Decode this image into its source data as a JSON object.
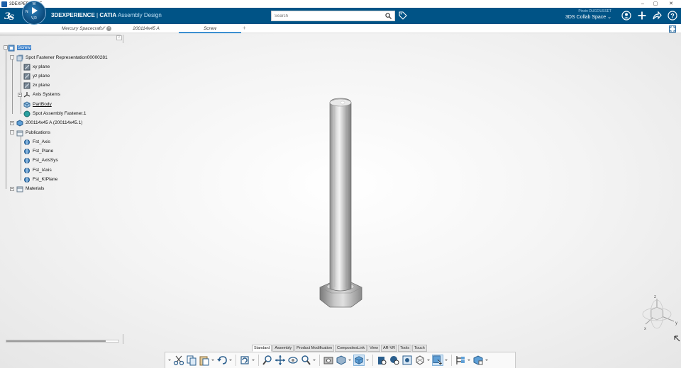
{
  "titlebar": {
    "title": "3DEXPERIENCE",
    "min": "–",
    "max": "▢",
    "close": "✕"
  },
  "header": {
    "brand_prefix": "3DEXPERIENCE",
    "brand_sep": " | ",
    "brand_product": "CATIA",
    "brand_app": " Assembly Design",
    "compass_top": "W",
    "compass_left": "N",
    "compass_label": "V,R",
    "search_placeholder": "Search",
    "user_name": "Pinxin DUGOUSSET",
    "collab_space": "3DS Collab Space ⌄"
  },
  "tabs": [
    {
      "label": "Mercury Spacecraft",
      "suffix": "⁄⁄",
      "closable": true,
      "active": false
    },
    {
      "label": "200114x45 A",
      "active": false
    },
    {
      "label": "Screw",
      "active": true
    }
  ],
  "tab_add": "+",
  "tree": {
    "root": "Screw",
    "nodes": [
      {
        "label": "Spot Fastener Representation00000281"
      },
      {
        "label": "xy plane"
      },
      {
        "label": "yz plane"
      },
      {
        "label": "zx plane"
      },
      {
        "label": "Axis Systems"
      },
      {
        "label": "PartBody"
      },
      {
        "label": "Spot Assembly Fastener.1"
      },
      {
        "label": "200114x45 A (200114x45.1)"
      },
      {
        "label": "Publications"
      },
      {
        "label": "Fst_Axis"
      },
      {
        "label": "Fst_Plane"
      },
      {
        "label": "Fst_AxisSys"
      },
      {
        "label": "Fst_IAxis"
      },
      {
        "label": "Fst_KIPlane"
      },
      {
        "label": "Materials"
      }
    ]
  },
  "compass3d": {
    "z": "z",
    "x": "x",
    "y": "y"
  },
  "action_tabs": [
    "Standard",
    "Assembly",
    "Product Modification",
    "CompositesLink",
    "View",
    "AR-VR",
    "Tools",
    "Touch"
  ],
  "active_action_tab": "Standard",
  "colors": {
    "topbar": "#005386",
    "selection": "#3d82cc",
    "accent_tab": "#3b8fd1"
  }
}
